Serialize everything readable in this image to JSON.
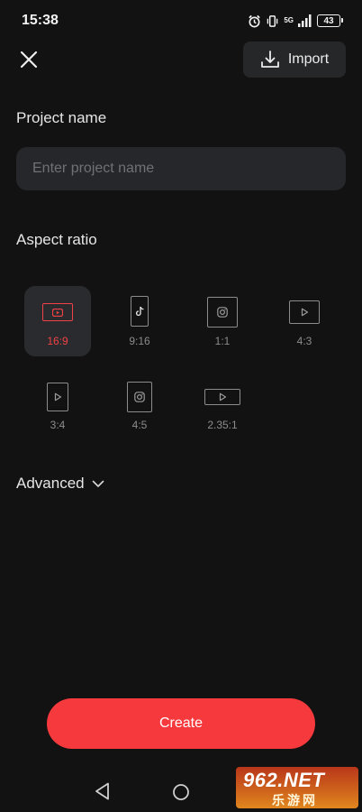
{
  "status_bar": {
    "time": "15:38",
    "network_label": "5G",
    "battery": "43"
  },
  "header": {
    "import_label": "Import"
  },
  "project_name": {
    "label": "Project name",
    "placeholder": "Enter project name",
    "value": ""
  },
  "aspect_ratio": {
    "label": "Aspect ratio",
    "selected": "16:9",
    "accent_color": "#f04246",
    "options": [
      {
        "label": "16:9",
        "icon": "youtube-icon"
      },
      {
        "label": "9:16",
        "icon": "tiktok-icon"
      },
      {
        "label": "1:1",
        "icon": "instagram-icon"
      },
      {
        "label": "4:3",
        "icon": "play-icon"
      },
      {
        "label": "3:4",
        "icon": "play-icon"
      },
      {
        "label": "4:5",
        "icon": "instagram-icon"
      },
      {
        "label": "2.35:1",
        "icon": "play-icon"
      }
    ]
  },
  "advanced": {
    "label": "Advanced"
  },
  "create": {
    "label": "Create",
    "color": "#f5393d"
  },
  "watermark": {
    "top": "962.NET",
    "bottom": "乐游网"
  }
}
